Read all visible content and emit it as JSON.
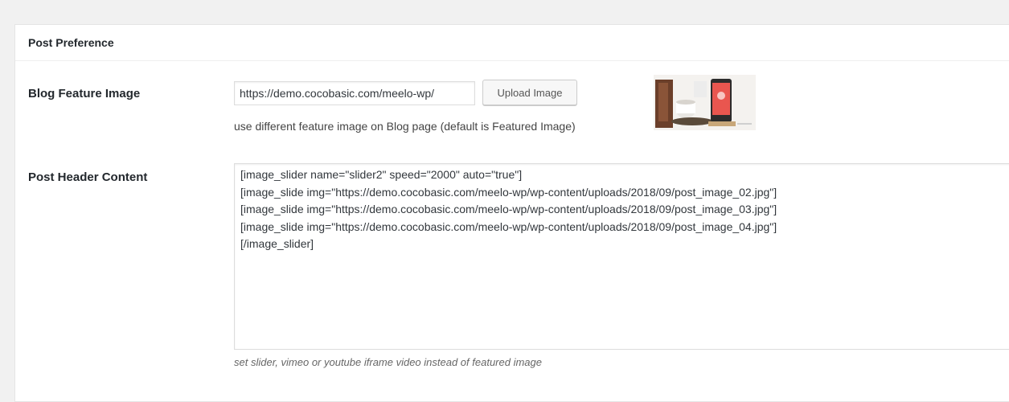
{
  "metabox": {
    "title": "Post Preference"
  },
  "fields": {
    "blog_feature_image": {
      "label": "Blog Feature Image",
      "value": "https://demo.cocobasic.com/meelo-wp/",
      "upload_label": "Upload Image",
      "help": "use different feature image on Blog page (default is Featured Image)",
      "thumbnail_icon": "image-thumbnail"
    },
    "post_header_content": {
      "label": "Post Header Content",
      "value": "[image_slider name=\"slider2\" speed=\"2000\" auto=\"true\"]\n[image_slide img=\"https://demo.cocobasic.com/meelo-wp/wp-content/uploads/2018/09/post_image_02.jpg\"]\n[image_slide img=\"https://demo.cocobasic.com/meelo-wp/wp-content/uploads/2018/09/post_image_03.jpg\"]\n[image_slide img=\"https://demo.cocobasic.com/meelo-wp/wp-content/uploads/2018/09/post_image_04.jpg\"]\n[/image_slider]",
      "help": "set slider, vimeo or youtube iframe video instead of featured image"
    }
  },
  "colors": {
    "background": "#f1f1f1",
    "panel": "#ffffff",
    "phone_screen": "#e9564f"
  }
}
